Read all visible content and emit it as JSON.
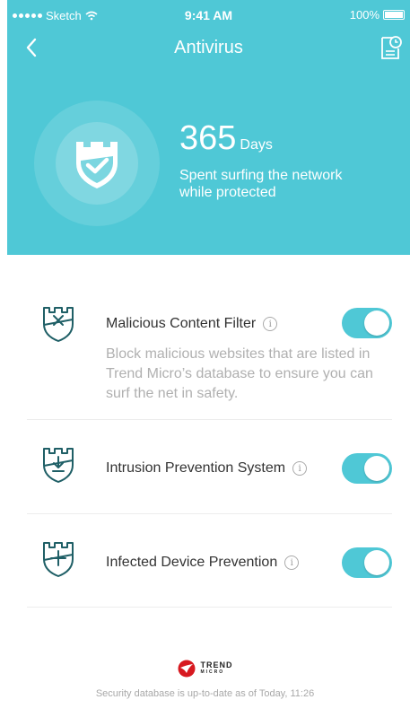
{
  "status_bar": {
    "carrier": "Sketch",
    "time": "9:41 AM",
    "battery": "100%"
  },
  "nav": {
    "title": "Antivirus",
    "back_icon": "chevron-left-icon",
    "history_icon": "report-history-icon"
  },
  "stats": {
    "days_value": "365",
    "days_unit": "Days",
    "description": "Spent surfing the network while protected"
  },
  "features": [
    {
      "title": "Malicious Content Filter",
      "description": "Block malicious websites that are listed in Trend Micro’s database to ensure you can surf the net in safety.",
      "icon": "shield-x-icon",
      "enabled": true
    },
    {
      "title": "Intrusion Prevention System",
      "description": "",
      "icon": "shield-download-icon",
      "enabled": true
    },
    {
      "title": "Infected Device Prevention",
      "description": "",
      "icon": "shield-plus-icon",
      "enabled": true
    }
  ],
  "footer": {
    "logo_text": "TREND",
    "logo_subtext": "MICRO",
    "update_text": "Security database is up-to-date as of Today, 11:26"
  },
  "colors": {
    "accent": "#4fc8d6",
    "icon_dark": "#1f5f66",
    "logo_red": "#d71920"
  }
}
